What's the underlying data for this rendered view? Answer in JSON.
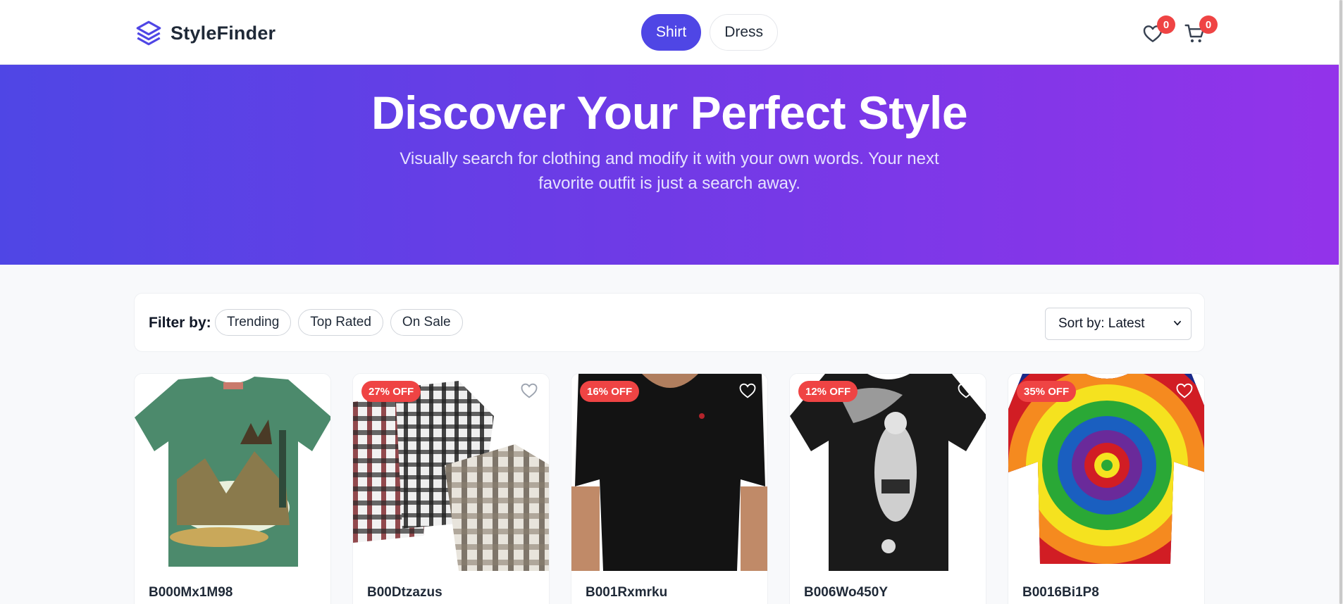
{
  "brand": {
    "name": "StyleFinder",
    "icon": "layers-icon",
    "color": "#4f46e5"
  },
  "categories": [
    {
      "label": "Shirt",
      "active": true
    },
    {
      "label": "Dress",
      "active": false
    }
  ],
  "header_icons": {
    "wishlist": {
      "icon": "heart-icon",
      "count": "0"
    },
    "cart": {
      "icon": "cart-icon",
      "count": "0"
    }
  },
  "hero": {
    "title": "Discover Your Perfect Style",
    "subtitle": "Visually search for clothing and modify it with your own words. Your next favorite outfit is just a search away."
  },
  "filters": {
    "label": "Filter by:",
    "chips": [
      "Trending",
      "Top Rated",
      "On Sale"
    ],
    "sort_value": "Sort by: Latest"
  },
  "products": [
    {
      "title": "B000Mx1M98",
      "discount": "",
      "image": "green elk t-shirt"
    },
    {
      "title": "B00Dtzazus",
      "discount": "27% OFF",
      "image": "plaid shirts stack"
    },
    {
      "title": "B001Rxmrku",
      "discount": "16% OFF",
      "image": "black polo on model"
    },
    {
      "title": "B006Wo450Y",
      "discount": "12% OFF",
      "image": "black graphic t-shirt"
    },
    {
      "title": "B0016Bi1P8",
      "discount": "35% OFF",
      "image": "tie-dye t-shirt"
    }
  ],
  "colors": {
    "accent": "#4f46e5",
    "badge": "#ef4444",
    "hero_start": "#4f46e5",
    "hero_end": "#9333ea"
  }
}
